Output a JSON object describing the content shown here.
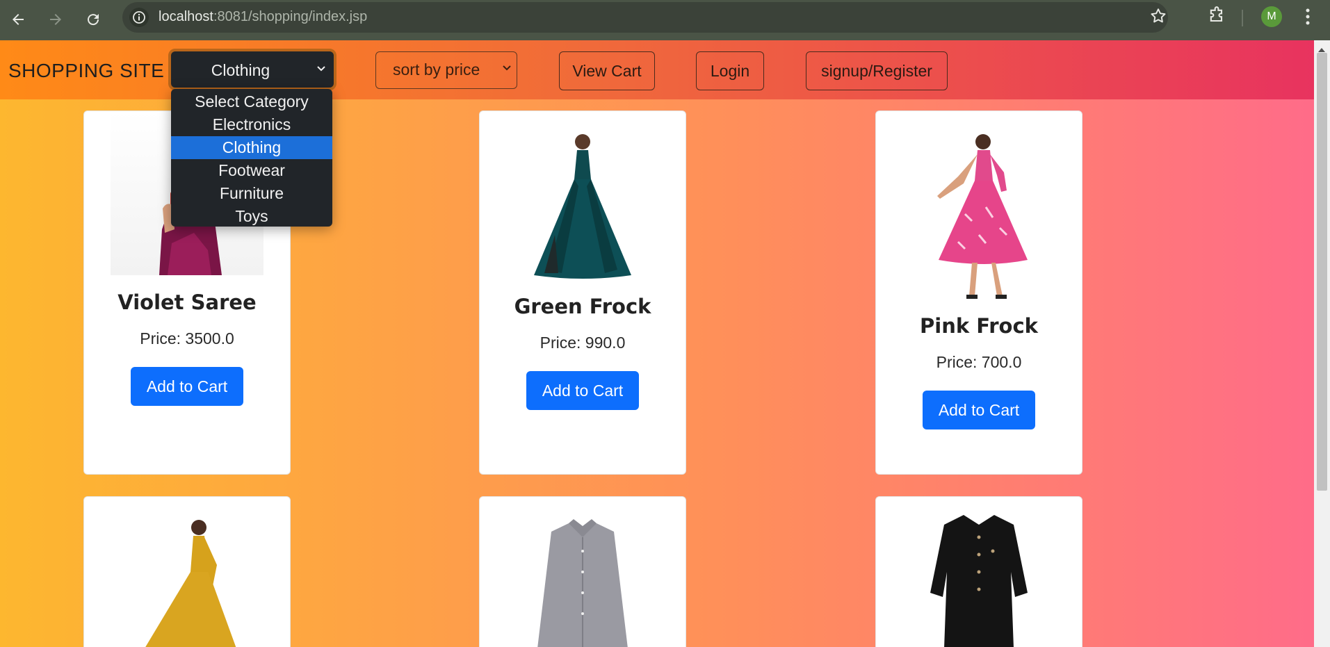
{
  "browser": {
    "url_host": "localhost",
    "url_port_path": ":8081/shopping/index.jsp",
    "avatar_letter": "M",
    "icons": [
      "back-arrow-icon",
      "forward-arrow-icon",
      "reload-icon",
      "site-info-icon",
      "bookmark-star-icon",
      "extensions-puzzle-icon",
      "menu-kebab-icon"
    ]
  },
  "navbar": {
    "brand": "SHOPPING SITE",
    "category_select": {
      "selected": "Clothing",
      "options": [
        "Select Category",
        "Electronics",
        "Clothing",
        "Footwear",
        "Furniture",
        "Toys"
      ]
    },
    "sort_select": {
      "selected": "sort by price"
    },
    "view_cart": "View Cart",
    "login": "Login",
    "signup": "signup/Register"
  },
  "products": [
    {
      "name": "Violet Saree",
      "price": "Price: 3500.0",
      "button": "Add to Cart",
      "image": "violet-saree-image"
    },
    {
      "name": "Green Frock",
      "price": "Price: 990.0",
      "button": "Add to Cart",
      "image": "green-frock-image"
    },
    {
      "name": "Pink Frock",
      "price": "Price: 700.0",
      "button": "Add to Cart",
      "image": "pink-frock-image"
    }
  ],
  "products_row2": [
    {
      "image": "yellow-dress-image"
    },
    {
      "image": "grey-shirt-image"
    },
    {
      "image": "black-shirt-image"
    }
  ],
  "colors": {
    "primary_button": "#0d6efd",
    "dropdown_bg": "#212529",
    "dropdown_selected": "#1c6fd9"
  }
}
